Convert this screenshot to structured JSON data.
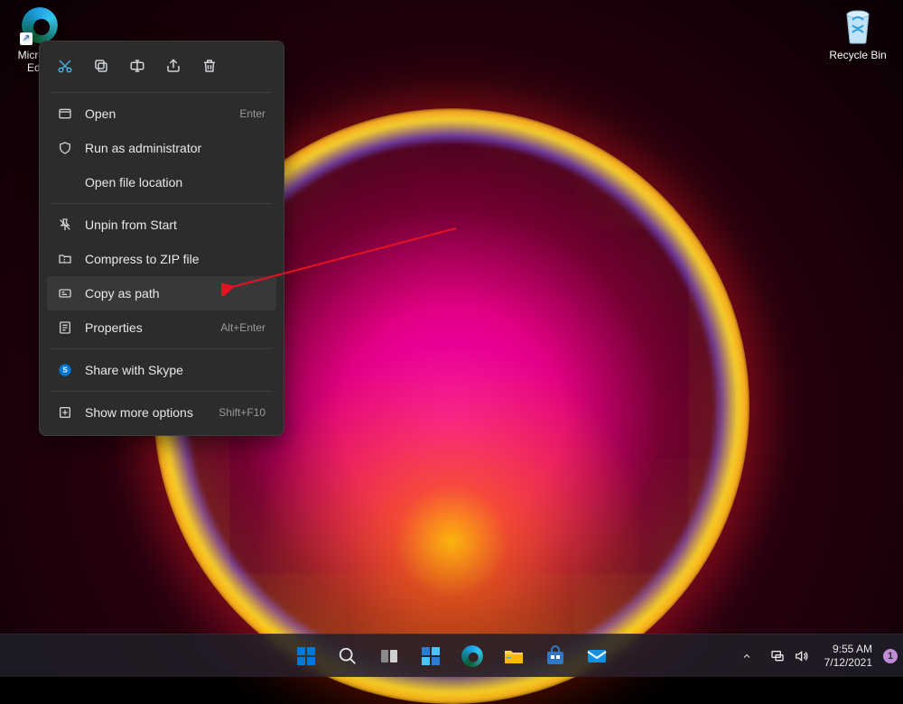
{
  "desktop": {
    "icons": [
      {
        "name": "Microsoft Edge",
        "kind": "edge"
      },
      {
        "name": "Recycle Bin",
        "kind": "recycle"
      }
    ]
  },
  "context_menu": {
    "icon_row": [
      {
        "name": "cut-icon"
      },
      {
        "name": "copy-icon"
      },
      {
        "name": "rename-icon"
      },
      {
        "name": "share-icon"
      },
      {
        "name": "delete-icon"
      }
    ],
    "groups": [
      [
        {
          "label": "Open",
          "accel": "Enter",
          "icon": "open"
        },
        {
          "label": "Run as administrator",
          "accel": "",
          "icon": "shield"
        },
        {
          "label": "Open file location",
          "accel": "",
          "icon": ""
        }
      ],
      [
        {
          "label": "Unpin from Start",
          "accel": "",
          "icon": "unpin"
        },
        {
          "label": "Compress to ZIP file",
          "accel": "",
          "icon": "zip"
        },
        {
          "label": "Copy as path",
          "accel": "",
          "icon": "path",
          "hover": true
        },
        {
          "label": "Properties",
          "accel": "Alt+Enter",
          "icon": "props"
        }
      ],
      [
        {
          "label": "Share with Skype",
          "accel": "",
          "icon": "skype"
        }
      ],
      [
        {
          "label": "Show more options",
          "accel": "Shift+F10",
          "icon": "more"
        }
      ]
    ]
  },
  "taskbar": {
    "apps": [
      "start",
      "search",
      "taskview",
      "widgets",
      "edge",
      "explorer",
      "store",
      "mail"
    ],
    "tray": {
      "chevron": true,
      "network_icon": "wifi",
      "volume_icon": "speaker"
    },
    "clock": {
      "time": "9:55 AM",
      "date": "7/12/2021"
    },
    "notifications": "1"
  }
}
